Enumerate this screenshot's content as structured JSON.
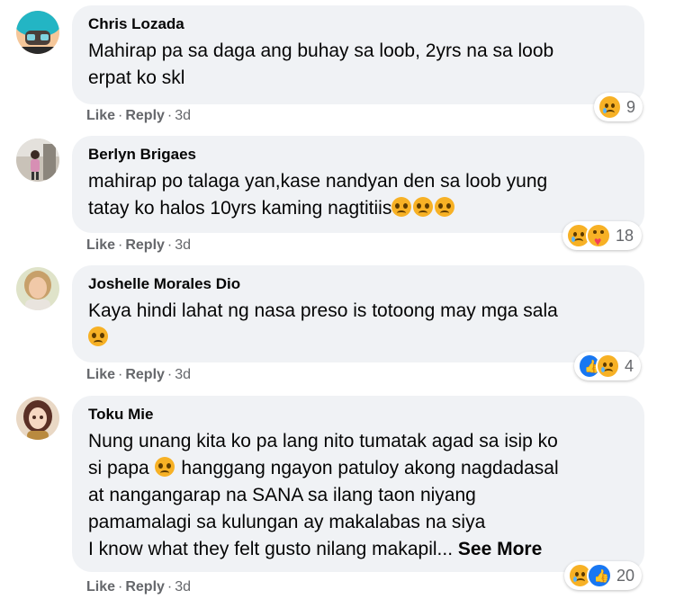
{
  "comments": [
    {
      "author": "Chris Lozada",
      "lines": [
        "Mahirap pa sa daga ang buhay sa loob, 2yrs na sa loob",
        "erpat ko skl"
      ],
      "like": "Like",
      "reply": "Reply",
      "time": "3d",
      "reactions": [
        "sad"
      ],
      "reaction_count": "9"
    },
    {
      "author": "Berlyn Brigaes",
      "lines": [
        "mahirap po talaga yan,kase nandyan den sa loob yung",
        "tatay ko halos 10yrs kaming nagtitiis"
      ],
      "like": "Like",
      "reply": "Reply",
      "time": "3d",
      "reactions": [
        "sad",
        "care"
      ],
      "reaction_count": "18"
    },
    {
      "author": "Joshelle Morales Dio",
      "lines": [
        "Kaya hindi lahat ng nasa preso is totoong may mga sala"
      ],
      "like": "Like",
      "reply": "Reply",
      "time": "3d",
      "reactions": [
        "like",
        "sad"
      ],
      "reaction_count": "4"
    },
    {
      "author": "Toku Mie",
      "lines": [
        "Nung unang kita ko pa lang nito tumatak agad sa isip ko",
        "si papa",
        "hanggang ngayon patuloy akong nagdadasal",
        "at nangangarap na SANA sa ilang taon niyang",
        "pamamalagi sa kulungan ay makalabas na siya",
        "I know what they felt gusto nilang makapil..."
      ],
      "see_more": "See More",
      "like": "Like",
      "reply": "Reply",
      "time": "3d",
      "reactions": [
        "sad",
        "like"
      ],
      "reaction_count": "20"
    }
  ],
  "colors": {
    "bubble": "#f0f2f5",
    "muted": "#65676b",
    "like_blue": "#1877f2",
    "emoji_yellow": "#f7b125"
  }
}
